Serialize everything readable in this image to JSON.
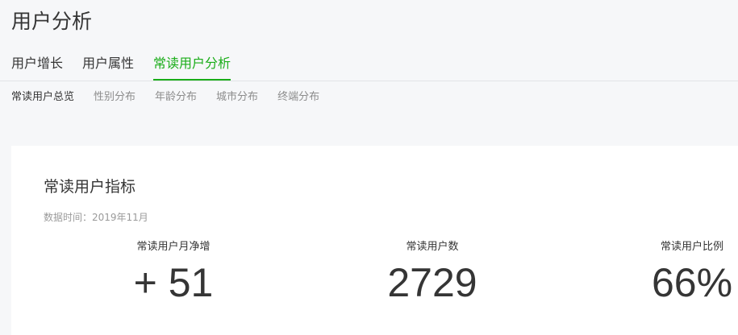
{
  "header": {
    "title": "用户分析"
  },
  "main_tabs": [
    {
      "label": "用户增长",
      "active": false
    },
    {
      "label": "用户属性",
      "active": false
    },
    {
      "label": "常读用户分析",
      "active": true
    }
  ],
  "sub_tabs": [
    {
      "label": "常读用户总览",
      "active": true
    },
    {
      "label": "性别分布",
      "active": false
    },
    {
      "label": "年龄分布",
      "active": false
    },
    {
      "label": "城市分布",
      "active": false
    },
    {
      "label": "终端分布",
      "active": false
    }
  ],
  "card": {
    "title": "常读用户指标",
    "data_time": "数据时间：2019年11月",
    "metrics": [
      {
        "label": "常读用户月净增",
        "value": "+ 51"
      },
      {
        "label": "常读用户数",
        "value": "2729"
      },
      {
        "label": "常读用户比例",
        "value": "66%"
      }
    ]
  },
  "colors": {
    "accent": "#1aad19",
    "background": "#f6f7f9",
    "card": "#ffffff",
    "text": "#353535",
    "muted": "#8c8c8c"
  }
}
